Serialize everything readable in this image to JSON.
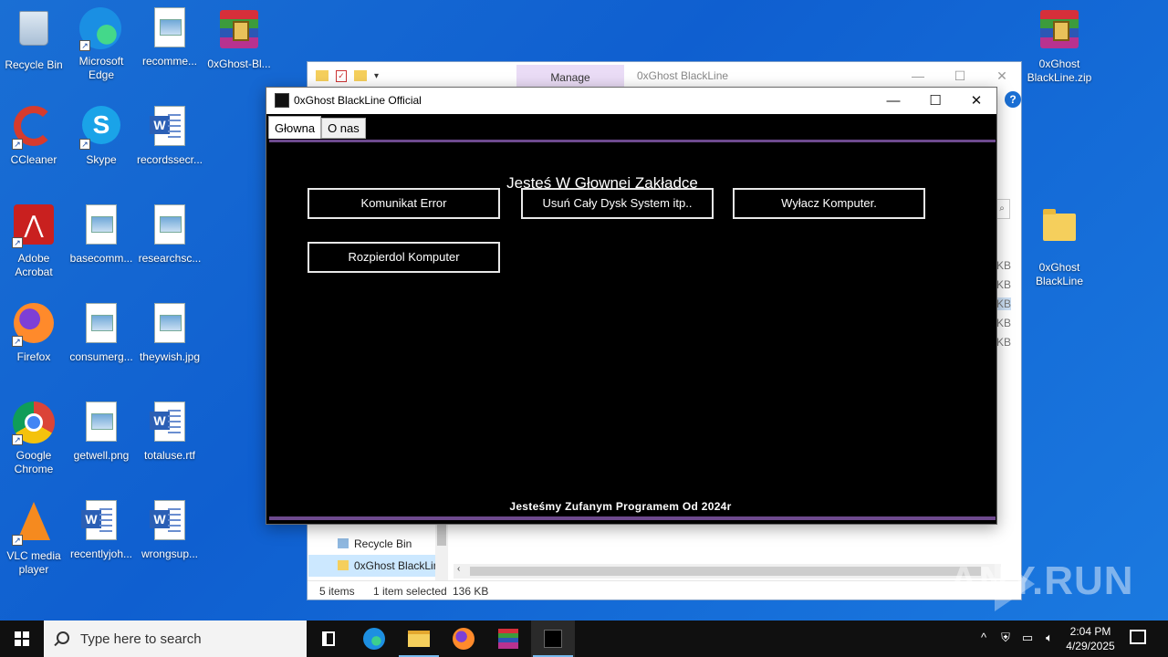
{
  "desktop": {
    "icons": [
      {
        "name": "recycle-bin-desktop-icon",
        "label": "Recycle Bin"
      },
      {
        "name": "microsoft-edge-desktop-icon",
        "label": "Microsoft Edge"
      },
      {
        "name": "recomme-desktop-icon",
        "label": "recomme..."
      },
      {
        "name": "oxghost-bl-desktop-icon",
        "label": "0xGhost-Bl..."
      },
      {
        "name": "oxghost-zip-desktop-icon",
        "label": "0xGhost BlackLine.zip"
      },
      {
        "name": "ccleaner-desktop-icon",
        "label": "CCleaner"
      },
      {
        "name": "skype-desktop-icon",
        "label": "Skype"
      },
      {
        "name": "recordssecr-desktop-icon",
        "label": "recordssecr..."
      },
      {
        "name": "adobe-acrobat-desktop-icon",
        "label": "Adobe Acrobat"
      },
      {
        "name": "basecomm-desktop-icon",
        "label": "basecomm..."
      },
      {
        "name": "researchsc-desktop-icon",
        "label": "researchsc..."
      },
      {
        "name": "oxghost-folder-desktop-icon",
        "label": "0xGhost BlackLine"
      },
      {
        "name": "firefox-desktop-icon",
        "label": "Firefox"
      },
      {
        "name": "consumerg-desktop-icon",
        "label": "consumerg..."
      },
      {
        "name": "theywish-desktop-icon",
        "label": "theywish.jpg"
      },
      {
        "name": "google-chrome-desktop-icon",
        "label": "Google Chrome"
      },
      {
        "name": "getwell-desktop-icon",
        "label": "getwell.png"
      },
      {
        "name": "totaluse-desktop-icon",
        "label": "totaluse.rtf"
      },
      {
        "name": "vlc-desktop-icon",
        "label": "VLC media player"
      },
      {
        "name": "recentlyjoh-desktop-icon",
        "label": "recentlyjoh..."
      },
      {
        "name": "wrongsup-desktop-icon",
        "label": "wrongsup..."
      }
    ]
  },
  "explorer": {
    "manage_tab": "Manage",
    "title": "0xGhost BlackLine",
    "size_column": [
      "KB",
      "KB",
      "KB",
      "KB",
      "KB"
    ],
    "nav": {
      "recycle_bin": "Recycle Bin",
      "selected_folder": "0xGhost BlackLin"
    },
    "status": {
      "items": "5 items",
      "selected": "1 item selected",
      "size": "136 KB"
    }
  },
  "app": {
    "window_title": "0xGhost BlackLine Official",
    "tabs": [
      {
        "label": "Głowna"
      },
      {
        "label": "O nas"
      }
    ],
    "heading": "Jesteś W Głownej Zakładce",
    "buttons": {
      "error": "Komunikat Error",
      "wipe": "Usuń Cały Dysk System itp..",
      "shutdown": "Wyłacz Komputer.",
      "destroy": "Rozpierdol Komputer"
    },
    "footer": "Jesteśmy Zufanym Programem Od 2024r"
  },
  "taskbar": {
    "search_placeholder": "Type here to search",
    "time": "2:04 PM",
    "date": "4/29/2025"
  },
  "watermark": "ANY.RUN"
}
